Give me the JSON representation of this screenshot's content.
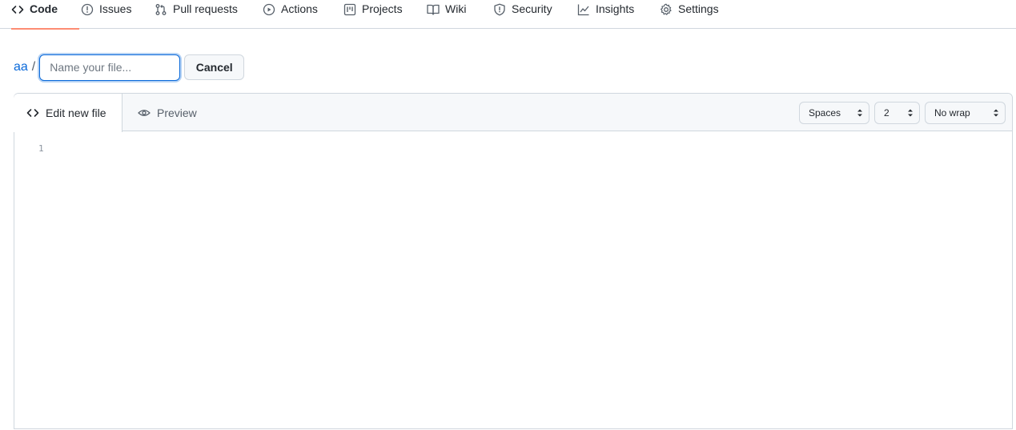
{
  "nav": {
    "tabs": [
      {
        "label": "Code",
        "icon": "code-icon"
      },
      {
        "label": "Issues",
        "icon": "issue-icon"
      },
      {
        "label": "Pull requests",
        "icon": "pull-request-icon"
      },
      {
        "label": "Actions",
        "icon": "play-icon"
      },
      {
        "label": "Projects",
        "icon": "project-icon"
      },
      {
        "label": "Wiki",
        "icon": "book-icon"
      },
      {
        "label": "Security",
        "icon": "shield-icon"
      },
      {
        "label": "Insights",
        "icon": "graph-icon"
      },
      {
        "label": "Settings",
        "icon": "gear-icon"
      }
    ],
    "selected": "Code",
    "accent_color": "#fd8c73"
  },
  "file": {
    "repo": "aa",
    "separator": "/",
    "filename_value": "",
    "filename_placeholder": "Name your file...",
    "cancel_label": "Cancel"
  },
  "editor": {
    "tabs": {
      "edit_label": "Edit new file",
      "preview_label": "Preview"
    },
    "indent_mode": "Spaces",
    "indent_size": "2",
    "wrap_mode": "No wrap",
    "line_numbers": [
      "1"
    ]
  }
}
